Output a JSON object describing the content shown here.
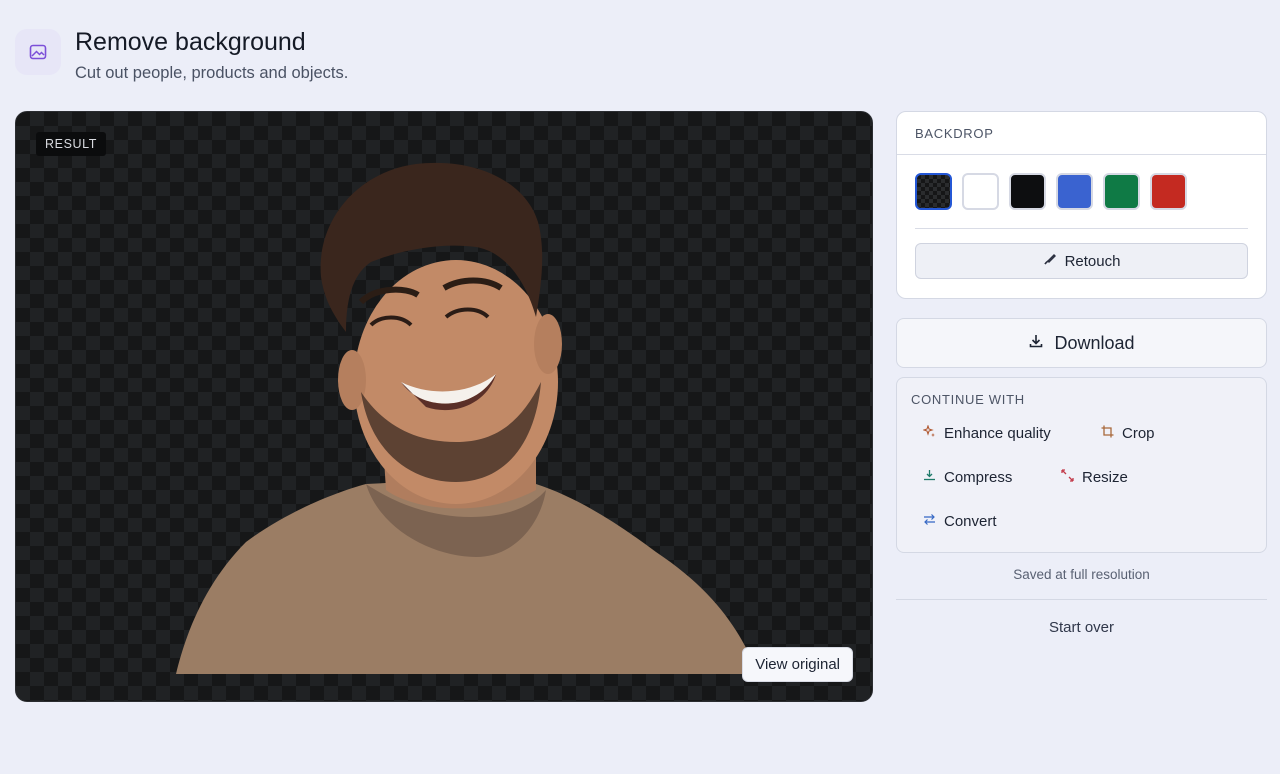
{
  "header": {
    "title": "Remove background",
    "subtitle": "Cut out people, products and objects.",
    "icon": "image-icon"
  },
  "canvas": {
    "badge": "RESULT",
    "view_original_label": "View original"
  },
  "backdrop": {
    "heading": "BACKDROP",
    "swatches": [
      {
        "name": "transparent",
        "color": "transparent",
        "selected": true
      },
      {
        "name": "white",
        "color": "#ffffff"
      },
      {
        "name": "black",
        "color": "#0d0e10"
      },
      {
        "name": "blue",
        "color": "#3a63d0"
      },
      {
        "name": "green",
        "color": "#0f7a45"
      },
      {
        "name": "red",
        "color": "#c42a21"
      }
    ],
    "retouch_label": "Retouch"
  },
  "download": {
    "label": "Download"
  },
  "continue": {
    "heading": "CONTINUE WITH",
    "tools": [
      {
        "label": "Enhance quality",
        "icon": "sparkle-icon"
      },
      {
        "label": "Crop",
        "icon": "crop-icon"
      },
      {
        "label": "Compress",
        "icon": "compress-icon"
      },
      {
        "label": "Resize",
        "icon": "resize-icon"
      },
      {
        "label": "Convert",
        "icon": "convert-icon"
      }
    ]
  },
  "status_note": "Saved at full resolution",
  "start_over_label": "Start over",
  "colors": {
    "accent": "#2457d6",
    "app_icon": "#7c4fd8"
  }
}
